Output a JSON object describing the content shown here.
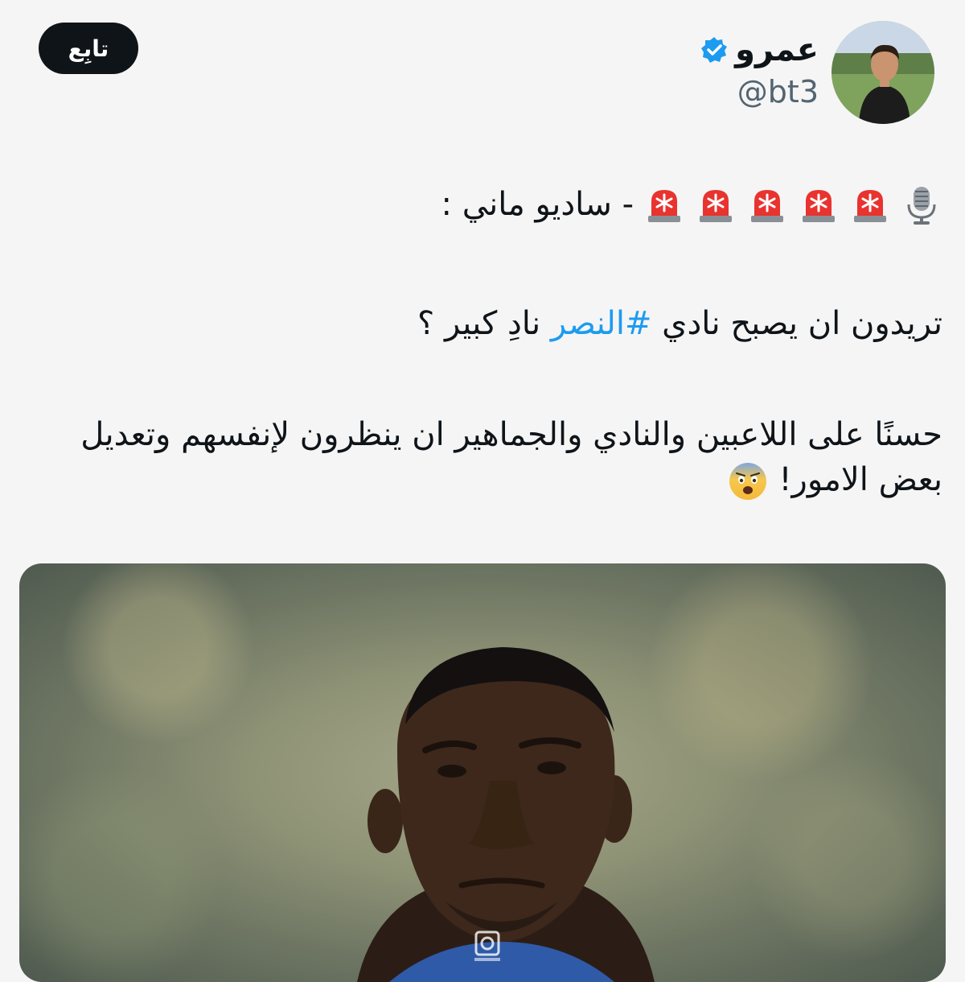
{
  "header": {
    "follow_label": "تابِع",
    "display_name": "عمرو",
    "handle": "@bt3"
  },
  "tweet": {
    "line1_text": "- ساديو ماني :",
    "line2_before": "تريدون ان يصبح نادي ",
    "line2_hashtag": "#النصر",
    "line2_after": " نادِ كبير ؟",
    "line3_text": "حسنًا على اللاعبين والنادي والجماهير ان ينظرون لإنفسهم وتعديل بعض الامور!",
    "line1_emojis": [
      "microphone-icon",
      "siren-icon",
      "siren-icon",
      "siren-icon",
      "siren-icon",
      "siren-icon"
    ],
    "line3_emoji": "fearful-face-icon"
  },
  "colors": {
    "background": "#f5f5f5",
    "follow_button": "#0f1419",
    "verified_badge": "#1d9bf0",
    "hashtag": "#1d9bf0",
    "handle_text": "#536471"
  }
}
